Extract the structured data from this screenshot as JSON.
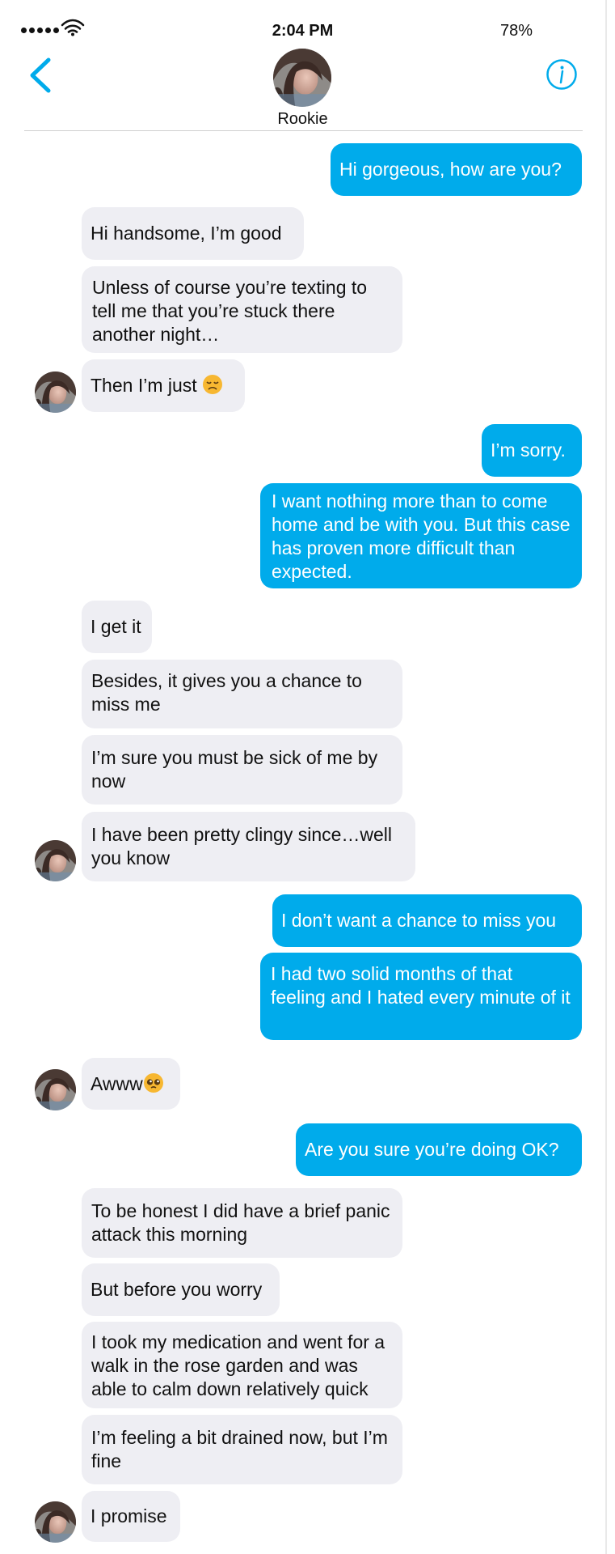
{
  "status_bar": {
    "time": "2:04 PM",
    "battery": "78%"
  },
  "header": {
    "contact_name": "Rookie"
  },
  "messages": [
    {
      "from": "me",
      "text": "Hi gorgeous, how are you?"
    },
    {
      "from": "them",
      "text": "Hi handsome, I’m good"
    },
    {
      "from": "them",
      "text": "Unless of course you’re texting to tell me that you’re stuck there another night…"
    },
    {
      "from": "them",
      "text": "Then I’m just",
      "emoji": "disappointed-face"
    },
    {
      "from": "me",
      "text": "I’m sorry."
    },
    {
      "from": "me",
      "text": "I want nothing more than to come home and be with you. But this case has proven more difficult than expected."
    },
    {
      "from": "them",
      "text": "I get it"
    },
    {
      "from": "them",
      "text": "Besides, it gives you a chance to miss me"
    },
    {
      "from": "them",
      "text": "I’m sure you must be sick of me by now"
    },
    {
      "from": "them",
      "text": "I have been pretty clingy since…well you know"
    },
    {
      "from": "me",
      "text": "I don’t want a chance to miss you"
    },
    {
      "from": "me",
      "text": "I had two solid months of that feeling and I hated every minute of it"
    },
    {
      "from": "them",
      "text": "Awww",
      "emoji": "pleading-face"
    },
    {
      "from": "me",
      "text": "Are you sure you’re doing OK?"
    },
    {
      "from": "them",
      "text": "To be honest I did have a brief panic attack this morning"
    },
    {
      "from": "them",
      "text": "But before you worry"
    },
    {
      "from": "them",
      "text": "I took my medication and went for a walk in the rose garden and was able to calm down relatively quick"
    },
    {
      "from": "them",
      "text": "I’m feeling a bit drained now, but I’m fine"
    },
    {
      "from": "them",
      "text": "I promise"
    }
  ],
  "colors": {
    "accent": "#00abeb",
    "incoming_bubble": "#eeeef3",
    "outgoing_bubble": "#00abeb"
  }
}
